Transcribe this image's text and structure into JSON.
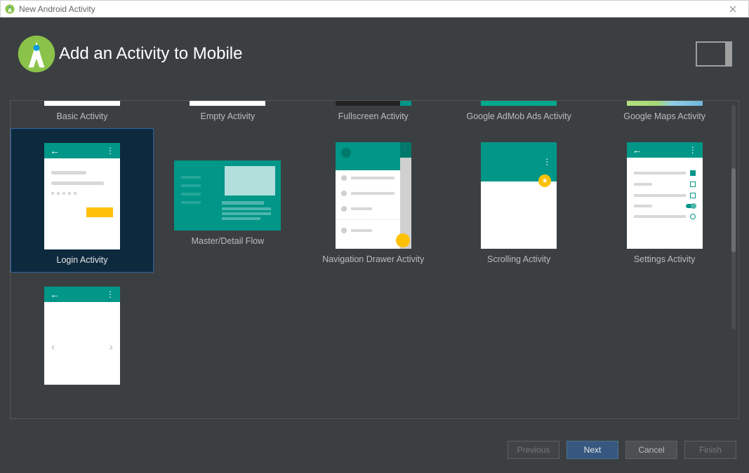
{
  "window": {
    "title": "New Android Activity"
  },
  "header": {
    "title": "Add an Activity to Mobile"
  },
  "row1": [
    {
      "label": "Basic Activity"
    },
    {
      "label": "Empty Activity"
    },
    {
      "label": "Fullscreen Activity"
    },
    {
      "label": "Google AdMob Ads Activity"
    },
    {
      "label": "Google Maps Activity"
    }
  ],
  "row2": [
    {
      "label": "Login Activity",
      "selected": true
    },
    {
      "label": "Master/Detail Flow"
    },
    {
      "label": "Navigation Drawer Activity"
    },
    {
      "label": "Scrolling Activity"
    },
    {
      "label": "Settings Activity"
    }
  ],
  "row3": [
    {
      "label": ""
    }
  ],
  "footer": {
    "previous": "Previous",
    "next": "Next",
    "cancel": "Cancel",
    "finish": "Finish"
  }
}
